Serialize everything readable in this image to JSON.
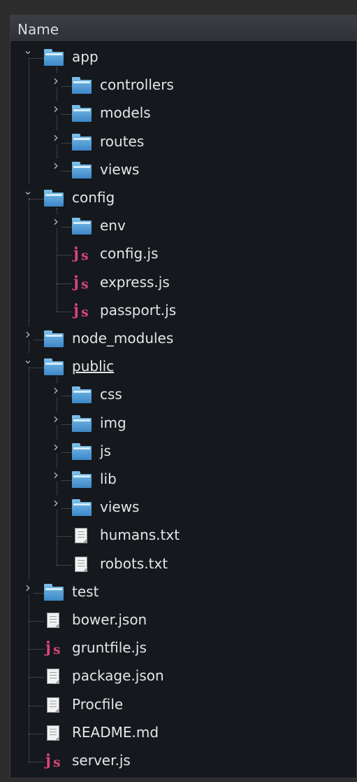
{
  "header": {
    "column_name": "Name"
  },
  "tree": [
    {
      "label": "app",
      "type": "folder",
      "depth": 0,
      "expanded": true
    },
    {
      "label": "controllers",
      "type": "folder",
      "depth": 1,
      "expanded": false
    },
    {
      "label": "models",
      "type": "folder",
      "depth": 1,
      "expanded": false
    },
    {
      "label": "routes",
      "type": "folder",
      "depth": 1,
      "expanded": false
    },
    {
      "label": "views",
      "type": "folder",
      "depth": 1,
      "expanded": false
    },
    {
      "label": "config",
      "type": "folder",
      "depth": 0,
      "expanded": true
    },
    {
      "label": "env",
      "type": "folder",
      "depth": 1,
      "expanded": false
    },
    {
      "label": "config.js",
      "type": "js",
      "depth": 1
    },
    {
      "label": "express.js",
      "type": "js",
      "depth": 1
    },
    {
      "label": "passport.js",
      "type": "js",
      "depth": 1
    },
    {
      "label": "node_modules",
      "type": "folder",
      "depth": 0,
      "expanded": false
    },
    {
      "label": "public",
      "type": "folder",
      "depth": 0,
      "expanded": true,
      "underlined": true
    },
    {
      "label": "css",
      "type": "folder",
      "depth": 1,
      "expanded": false
    },
    {
      "label": "img",
      "type": "folder",
      "depth": 1,
      "expanded": false
    },
    {
      "label": "js",
      "type": "folder",
      "depth": 1,
      "expanded": false
    },
    {
      "label": "lib",
      "type": "folder",
      "depth": 1,
      "expanded": false
    },
    {
      "label": "views",
      "type": "folder",
      "depth": 1,
      "expanded": false
    },
    {
      "label": "humans.txt",
      "type": "txt",
      "depth": 1
    },
    {
      "label": "robots.txt",
      "type": "txt",
      "depth": 1
    },
    {
      "label": "test",
      "type": "folder",
      "depth": 0,
      "expanded": false
    },
    {
      "label": "bower.json",
      "type": "txt",
      "depth": 0
    },
    {
      "label": "gruntfile.js",
      "type": "js",
      "depth": 0
    },
    {
      "label": "package.json",
      "type": "txt",
      "depth": 0
    },
    {
      "label": "Procfile",
      "type": "txt",
      "depth": 0
    },
    {
      "label": "README.md",
      "type": "txt",
      "depth": 0
    },
    {
      "label": "server.js",
      "type": "js",
      "depth": 0
    }
  ]
}
